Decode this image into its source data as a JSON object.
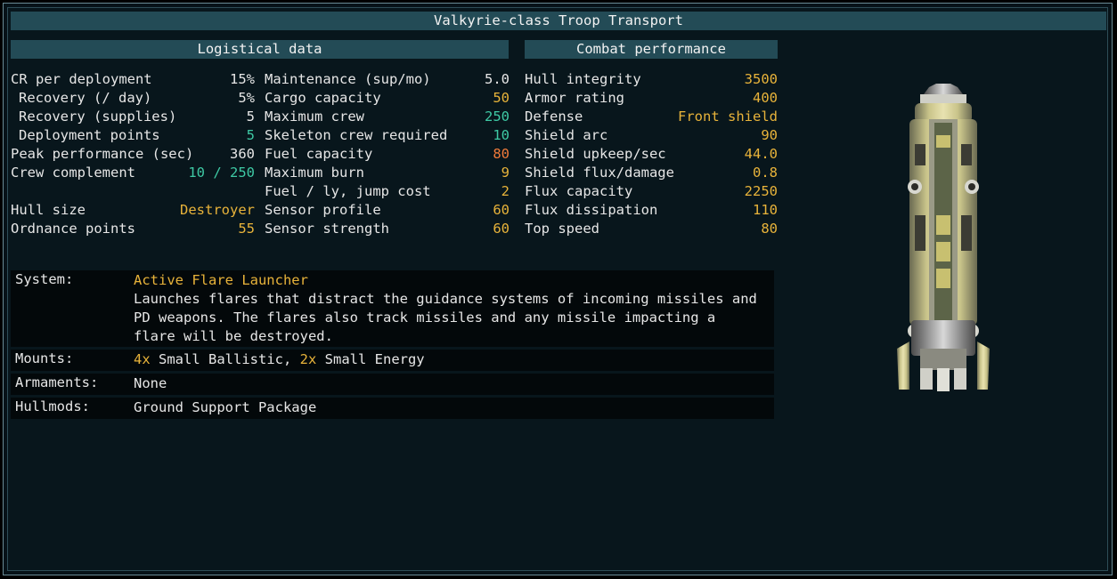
{
  "title": "Valkyrie-class Troop Transport",
  "sections": {
    "logistical": "Logistical data",
    "combat": "Combat performance"
  },
  "logistics_col1": [
    {
      "label": "CR per deployment",
      "value": "15%",
      "color": "white",
      "indent": false
    },
    {
      "label": "Recovery (/ day)",
      "value": "5%",
      "color": "white",
      "indent": true
    },
    {
      "label": "Recovery (supplies)",
      "value": "5",
      "color": "white",
      "indent": true
    },
    {
      "label": "Deployment points",
      "value": "5",
      "color": "teal",
      "indent": true
    },
    {
      "label": "Peak performance (sec)",
      "value": "360",
      "color": "white",
      "indent": false
    },
    {
      "label": "Crew complement",
      "value": "10 / 250",
      "color": "teal",
      "indent": false
    },
    {
      "label": "",
      "value": "",
      "color": "white",
      "indent": false
    },
    {
      "label": "Hull size",
      "value": "Destroyer",
      "color": "gold",
      "indent": false
    },
    {
      "label": "Ordnance points",
      "value": "55",
      "color": "gold",
      "indent": false
    }
  ],
  "logistics_col2": [
    {
      "label": "Maintenance (sup/mo)",
      "value": "5.0",
      "color": "white"
    },
    {
      "label": "Cargo capacity",
      "value": "50",
      "color": "gold"
    },
    {
      "label": "Maximum crew",
      "value": "250",
      "color": "teal"
    },
    {
      "label": "Skeleton crew required",
      "value": "10",
      "color": "teal"
    },
    {
      "label": "Fuel capacity",
      "value": "80",
      "color": "orange"
    },
    {
      "label": "Maximum burn",
      "value": "9",
      "color": "gold"
    },
    {
      "label": "Fuel / ly, jump cost",
      "value": "2",
      "color": "gold"
    },
    {
      "label": "Sensor profile",
      "value": "60",
      "color": "gold"
    },
    {
      "label": "Sensor strength",
      "value": "60",
      "color": "gold"
    }
  ],
  "combat": [
    {
      "label": "Hull integrity",
      "value": "3500",
      "color": "gold"
    },
    {
      "label": "Armor rating",
      "value": "400",
      "color": "gold"
    },
    {
      "label": "Defense",
      "value": "Front shield",
      "color": "gold"
    },
    {
      "label": "Shield arc",
      "value": "90",
      "color": "gold"
    },
    {
      "label": "Shield upkeep/sec",
      "value": "44.0",
      "color": "gold"
    },
    {
      "label": "Shield flux/damage",
      "value": "0.8",
      "color": "gold"
    },
    {
      "label": "Flux capacity",
      "value": "2250",
      "color": "gold"
    },
    {
      "label": "Flux dissipation",
      "value": "110",
      "color": "gold"
    },
    {
      "label": "Top speed",
      "value": "80",
      "color": "gold"
    }
  ],
  "info": {
    "system_label": "System:",
    "system_name": "Active Flare Launcher",
    "system_desc": "Launches flares that distract the guidance systems of incoming missiles and PD weapons. The flares also track missiles and any missile impacting a flare will be destroyed.",
    "mounts_label": "Mounts:",
    "mounts_ballistic_count": "4x",
    "mounts_ballistic": " Small Ballistic, ",
    "mounts_energy_count": "2x",
    "mounts_energy": " Small Energy",
    "armaments_label": "Armaments:",
    "armaments_value": "None",
    "hullmods_label": "Hullmods:",
    "hullmods_value": "Ground Support Package"
  },
  "colors": {
    "white": "#e6e6e6",
    "gold": "#e8b33a",
    "teal": "#3ec9a4",
    "orange": "#f07a3a",
    "header_bg": "#234b56"
  },
  "ship_icon": "valkyrie-ship-sprite"
}
